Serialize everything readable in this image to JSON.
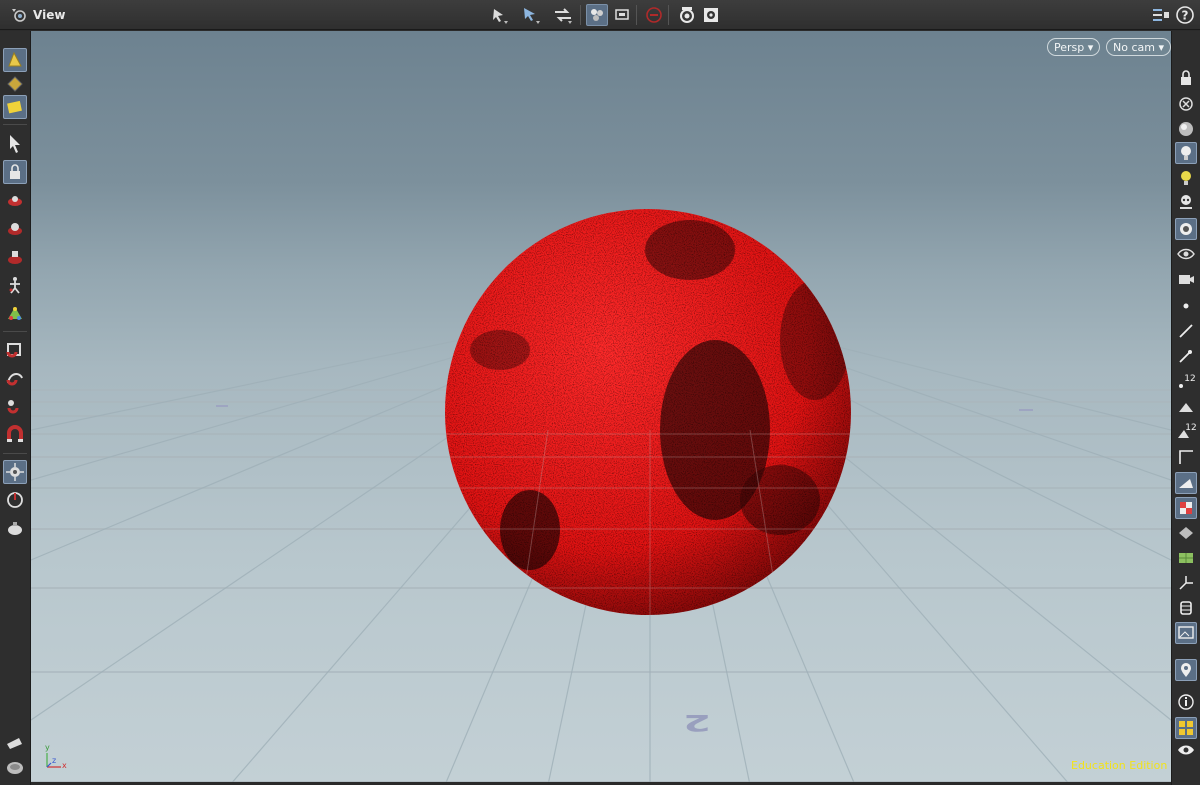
{
  "header": {
    "title": "View",
    "icons": [
      "viewport-menu-icon",
      "select-obj-icon",
      "select-move-icon",
      "select-rotate-icon",
      "sphere-toggle-icon",
      "display-icon",
      "no-entry-icon",
      "camera-snap-icon",
      "render-settings-icon",
      "display-options-icon",
      "help-icon"
    ]
  },
  "viewport": {
    "camera_view": "Persp",
    "camera_choice": "No cam",
    "watermark": "Education Edition",
    "axis": {
      "x": "x",
      "y": "y",
      "z": "z"
    },
    "grid_labels": [
      "2"
    ],
    "colors": {
      "sphere": "#ff1a1a",
      "sky_top": "#6d8290",
      "ground": "#c3d0d5",
      "accent": "#5b6f86"
    }
  },
  "left_toolbar": {
    "tools": [
      "particle-paint-icon",
      "pour-icon",
      "select-mode-icon",
      "select-arrow-icon",
      "lock-icon",
      "move-handle-icon",
      "rotate-handle-icon",
      "scale-handle-icon",
      "pose-icon",
      "stroke-icon",
      "magnet-icon",
      "magnet-2-icon",
      "magnet-3-icon",
      "snap-icon",
      "handle-icon",
      "brush-icon",
      "camera-icon",
      "teapot-icon"
    ]
  },
  "right_toolbar": {
    "tools": [
      "lock-icon",
      "close-icon",
      "sphere-icon",
      "light-icon",
      "lightbulb-icon",
      "skull-icon",
      "shader-icon",
      "eye-cam-icon",
      "cam-settings-icon",
      "point-icon",
      "line-icon",
      "brush-icon",
      "point-number-icon",
      "prim-number-icon",
      "corner-icon",
      "ramp-icon",
      "checker-icon",
      "layer-icon",
      "uv-icon",
      "axis-icon",
      "cylinder-icon",
      "image-icon",
      "location-icon",
      "info-icon",
      "grid-icon",
      "eye-icon"
    ],
    "labels": {
      "point_number": "12",
      "prim_number": "12"
    }
  }
}
